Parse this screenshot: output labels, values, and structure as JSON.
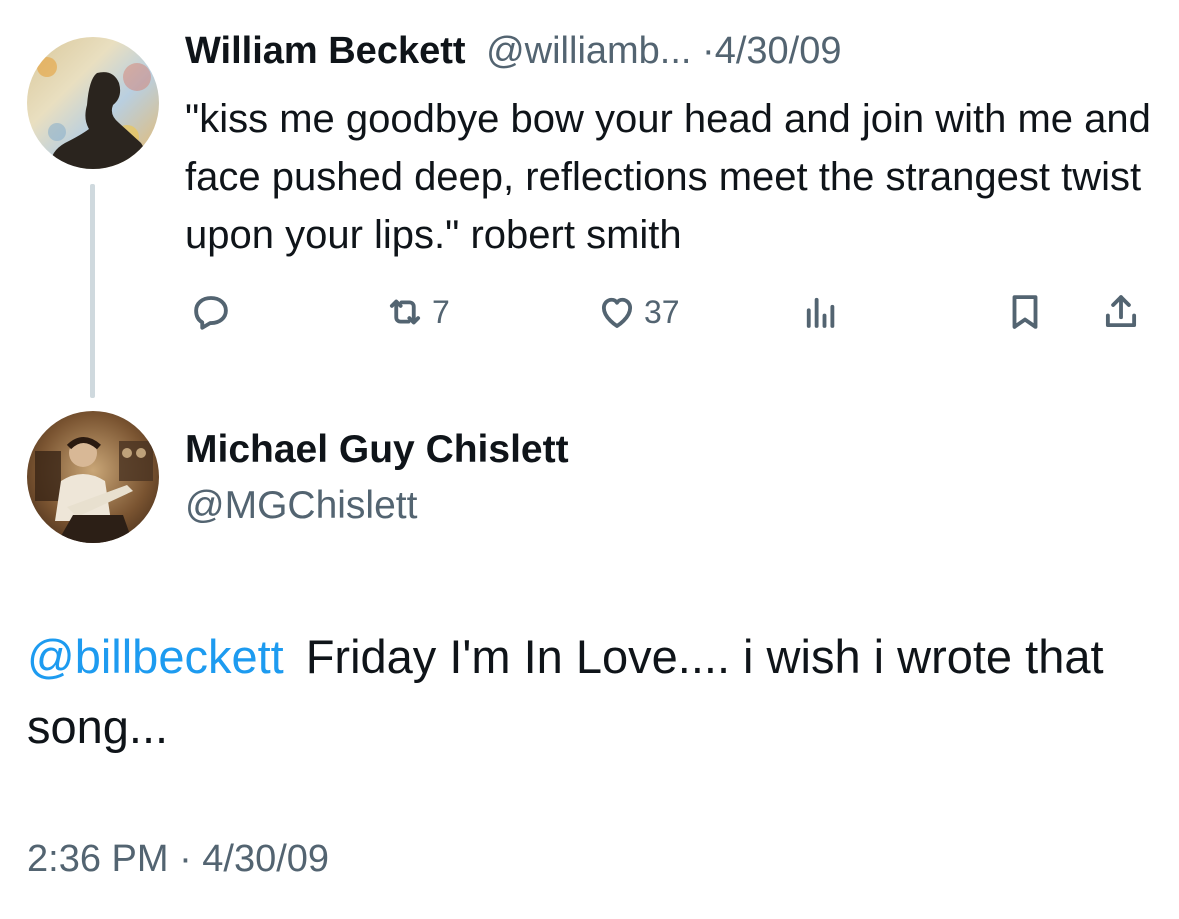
{
  "parent_tweet": {
    "author_name": "William Beckett",
    "author_handle": "@williamb...",
    "separator": "·",
    "date": "4/30/09",
    "text": "\"kiss me goodbye bow your head and join with me and face pushed deep, reflections meet the strangest twist upon your lips.\" robert smith",
    "actions": {
      "reply_icon": "reply-icon",
      "retweet_count": "7",
      "like_count": "37",
      "views_icon": "views-icon",
      "bookmark_icon": "bookmark-icon",
      "share_icon": "share-icon"
    }
  },
  "reply_tweet": {
    "author_name": "Michael Guy Chislett",
    "author_handle": "@MGChislett",
    "mention": "@billbeckett",
    "text": "Friday I'm In Love.... i wish i wrote that song...",
    "timestamp": "2:36 PM · 4/30/09"
  },
  "colors": {
    "text": "#0f1419",
    "muted": "#536471",
    "link": "#1d9bf0",
    "thread_line": "#cfd9de"
  }
}
